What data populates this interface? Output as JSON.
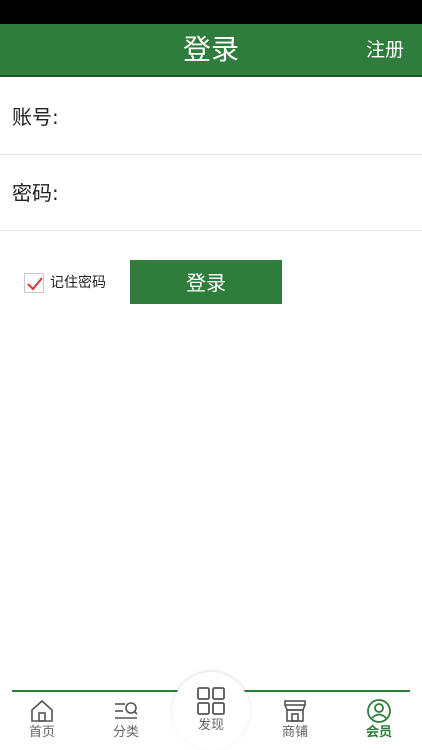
{
  "header": {
    "title": "登录",
    "register_label": "注册"
  },
  "form": {
    "account_label": "账号:",
    "password_label": "密码:",
    "remember_label": "记住密码",
    "remember_checked": true,
    "login_button": "登录"
  },
  "tabbar": {
    "items": [
      {
        "label": "首页",
        "icon": "home-icon"
      },
      {
        "label": "分类",
        "icon": "category-search-icon"
      },
      {
        "label": "发现",
        "icon": "grid-icon"
      },
      {
        "label": "商铺",
        "icon": "shop-icon"
      },
      {
        "label": "会员",
        "icon": "user-icon",
        "active": true
      }
    ]
  },
  "colors": {
    "primary": "#2e7d3c",
    "status_bar": "#000000",
    "checkbox_mark": "#d9363e"
  }
}
